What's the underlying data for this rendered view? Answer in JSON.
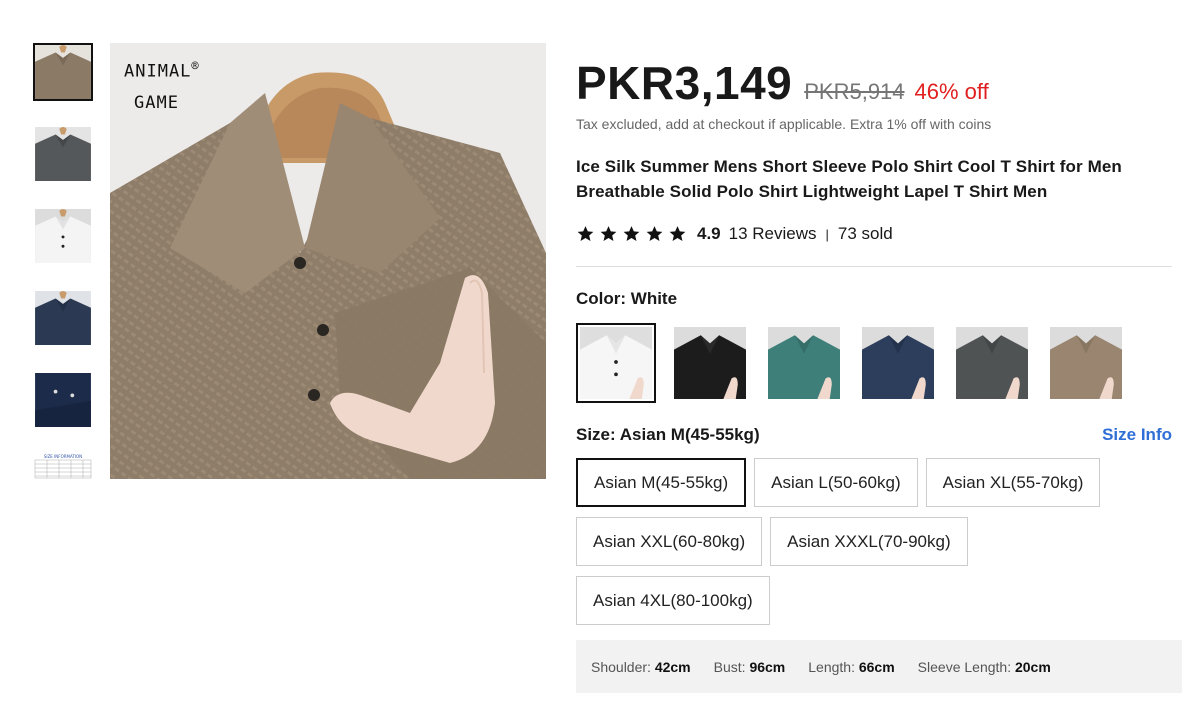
{
  "brand": {
    "name_line1": "ANIMAL",
    "name_line2": "GAME",
    "reg_mark": "®"
  },
  "thumbnails": [
    {
      "name": "khaki-shirt-thumb",
      "color": "#8b7a66"
    },
    {
      "name": "gray-shirt-thumb",
      "color": "#55585a"
    },
    {
      "name": "white-shirt-thumb",
      "color": "#eeeeee"
    },
    {
      "name": "navy-shirt-thumb",
      "color": "#2b3a52"
    },
    {
      "name": "dark-navy-shirt-thumb",
      "color": "#1c2b4a"
    },
    {
      "name": "size-chart-thumb",
      "label": "SIZE INFORMATION"
    }
  ],
  "pricing": {
    "price": "PKR3,149",
    "original_price": "PKR5,914",
    "discount": "46% off",
    "tax_note": "Tax excluded, add at checkout if applicable. Extra 1% off with coins"
  },
  "product": {
    "title": "Ice Silk Summer Mens Short Sleeve Polo Shirt Cool T Shirt for Men Breathable Solid Polo Shirt Lightweight Lapel T Shirt Men"
  },
  "rating": {
    "value": "4.9",
    "stars": 5,
    "reviews": "13 Reviews",
    "separator": "|",
    "sold": "73 sold"
  },
  "color": {
    "label": "Color: ",
    "selected": "White",
    "options": [
      {
        "name": "white",
        "hex": "#f2f2f2"
      },
      {
        "name": "black",
        "hex": "#1c1c1c"
      },
      {
        "name": "teal",
        "hex": "#3f7f7a"
      },
      {
        "name": "navy",
        "hex": "#2d3e5c"
      },
      {
        "name": "gray",
        "hex": "#505354"
      },
      {
        "name": "khaki",
        "hex": "#9a8670"
      }
    ]
  },
  "size": {
    "label": "Size: ",
    "selected": "Asian M(45-55kg)",
    "info_link": "Size Info",
    "options": [
      "Asian M(45-55kg)",
      "Asian L(50-60kg)",
      "Asian XL(55-70kg)",
      "Asian XXL(60-80kg)",
      "Asian XXXL(70-90kg)",
      "Asian 4XL(80-100kg)"
    ]
  },
  "measurements": [
    {
      "label": "Shoulder: ",
      "value": "42cm"
    },
    {
      "label": "Bust: ",
      "value": "96cm"
    },
    {
      "label": "Length: ",
      "value": "66cm"
    },
    {
      "label": "Sleeve Length: ",
      "value": "20cm"
    }
  ]
}
